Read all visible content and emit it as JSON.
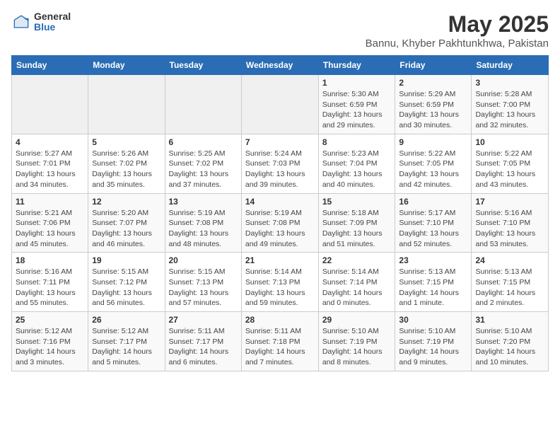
{
  "header": {
    "logo_general": "General",
    "logo_blue": "Blue",
    "title": "May 2025",
    "subtitle": "Bannu, Khyber Pakhtunkhwa, Pakistan"
  },
  "days_of_week": [
    "Sunday",
    "Monday",
    "Tuesday",
    "Wednesday",
    "Thursday",
    "Friday",
    "Saturday"
  ],
  "weeks": [
    [
      {
        "day": "",
        "info": ""
      },
      {
        "day": "",
        "info": ""
      },
      {
        "day": "",
        "info": ""
      },
      {
        "day": "",
        "info": ""
      },
      {
        "day": "1",
        "info": "Sunrise: 5:30 AM\nSunset: 6:59 PM\nDaylight: 13 hours\nand 29 minutes."
      },
      {
        "day": "2",
        "info": "Sunrise: 5:29 AM\nSunset: 6:59 PM\nDaylight: 13 hours\nand 30 minutes."
      },
      {
        "day": "3",
        "info": "Sunrise: 5:28 AM\nSunset: 7:00 PM\nDaylight: 13 hours\nand 32 minutes."
      }
    ],
    [
      {
        "day": "4",
        "info": "Sunrise: 5:27 AM\nSunset: 7:01 PM\nDaylight: 13 hours\nand 34 minutes."
      },
      {
        "day": "5",
        "info": "Sunrise: 5:26 AM\nSunset: 7:02 PM\nDaylight: 13 hours\nand 35 minutes."
      },
      {
        "day": "6",
        "info": "Sunrise: 5:25 AM\nSunset: 7:02 PM\nDaylight: 13 hours\nand 37 minutes."
      },
      {
        "day": "7",
        "info": "Sunrise: 5:24 AM\nSunset: 7:03 PM\nDaylight: 13 hours\nand 39 minutes."
      },
      {
        "day": "8",
        "info": "Sunrise: 5:23 AM\nSunset: 7:04 PM\nDaylight: 13 hours\nand 40 minutes."
      },
      {
        "day": "9",
        "info": "Sunrise: 5:22 AM\nSunset: 7:05 PM\nDaylight: 13 hours\nand 42 minutes."
      },
      {
        "day": "10",
        "info": "Sunrise: 5:22 AM\nSunset: 7:05 PM\nDaylight: 13 hours\nand 43 minutes."
      }
    ],
    [
      {
        "day": "11",
        "info": "Sunrise: 5:21 AM\nSunset: 7:06 PM\nDaylight: 13 hours\nand 45 minutes."
      },
      {
        "day": "12",
        "info": "Sunrise: 5:20 AM\nSunset: 7:07 PM\nDaylight: 13 hours\nand 46 minutes."
      },
      {
        "day": "13",
        "info": "Sunrise: 5:19 AM\nSunset: 7:08 PM\nDaylight: 13 hours\nand 48 minutes."
      },
      {
        "day": "14",
        "info": "Sunrise: 5:19 AM\nSunset: 7:08 PM\nDaylight: 13 hours\nand 49 minutes."
      },
      {
        "day": "15",
        "info": "Sunrise: 5:18 AM\nSunset: 7:09 PM\nDaylight: 13 hours\nand 51 minutes."
      },
      {
        "day": "16",
        "info": "Sunrise: 5:17 AM\nSunset: 7:10 PM\nDaylight: 13 hours\nand 52 minutes."
      },
      {
        "day": "17",
        "info": "Sunrise: 5:16 AM\nSunset: 7:10 PM\nDaylight: 13 hours\nand 53 minutes."
      }
    ],
    [
      {
        "day": "18",
        "info": "Sunrise: 5:16 AM\nSunset: 7:11 PM\nDaylight: 13 hours\nand 55 minutes."
      },
      {
        "day": "19",
        "info": "Sunrise: 5:15 AM\nSunset: 7:12 PM\nDaylight: 13 hours\nand 56 minutes."
      },
      {
        "day": "20",
        "info": "Sunrise: 5:15 AM\nSunset: 7:13 PM\nDaylight: 13 hours\nand 57 minutes."
      },
      {
        "day": "21",
        "info": "Sunrise: 5:14 AM\nSunset: 7:13 PM\nDaylight: 13 hours\nand 59 minutes."
      },
      {
        "day": "22",
        "info": "Sunrise: 5:14 AM\nSunset: 7:14 PM\nDaylight: 14 hours\nand 0 minutes."
      },
      {
        "day": "23",
        "info": "Sunrise: 5:13 AM\nSunset: 7:15 PM\nDaylight: 14 hours\nand 1 minute."
      },
      {
        "day": "24",
        "info": "Sunrise: 5:13 AM\nSunset: 7:15 PM\nDaylight: 14 hours\nand 2 minutes."
      }
    ],
    [
      {
        "day": "25",
        "info": "Sunrise: 5:12 AM\nSunset: 7:16 PM\nDaylight: 14 hours\nand 3 minutes."
      },
      {
        "day": "26",
        "info": "Sunrise: 5:12 AM\nSunset: 7:17 PM\nDaylight: 14 hours\nand 5 minutes."
      },
      {
        "day": "27",
        "info": "Sunrise: 5:11 AM\nSunset: 7:17 PM\nDaylight: 14 hours\nand 6 minutes."
      },
      {
        "day": "28",
        "info": "Sunrise: 5:11 AM\nSunset: 7:18 PM\nDaylight: 14 hours\nand 7 minutes."
      },
      {
        "day": "29",
        "info": "Sunrise: 5:10 AM\nSunset: 7:19 PM\nDaylight: 14 hours\nand 8 minutes."
      },
      {
        "day": "30",
        "info": "Sunrise: 5:10 AM\nSunset: 7:19 PM\nDaylight: 14 hours\nand 9 minutes."
      },
      {
        "day": "31",
        "info": "Sunrise: 5:10 AM\nSunset: 7:20 PM\nDaylight: 14 hours\nand 10 minutes."
      }
    ]
  ]
}
